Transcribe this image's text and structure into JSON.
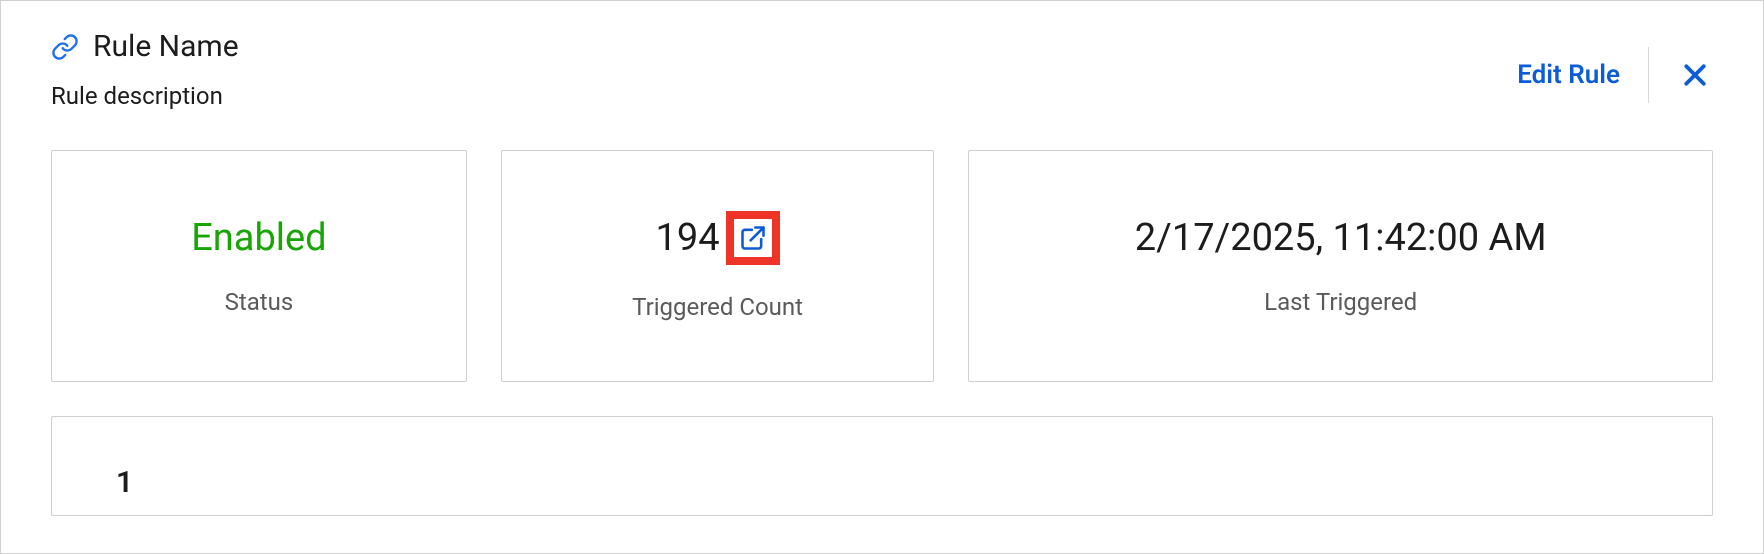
{
  "header": {
    "title": "Rule Name",
    "description": "Rule description",
    "edit_label": "Edit Rule"
  },
  "cards": {
    "status": {
      "value": "Enabled",
      "label": "Status"
    },
    "triggered_count": {
      "value": "194",
      "label": "Triggered Count"
    },
    "last_triggered": {
      "value": "2/17/2025, 11:42:00 AM",
      "label": "Last Triggered"
    }
  },
  "lower_panel": {
    "number": "1"
  },
  "icons": {
    "link": "link-icon",
    "close": "close-icon",
    "open_external": "open-external-icon"
  }
}
